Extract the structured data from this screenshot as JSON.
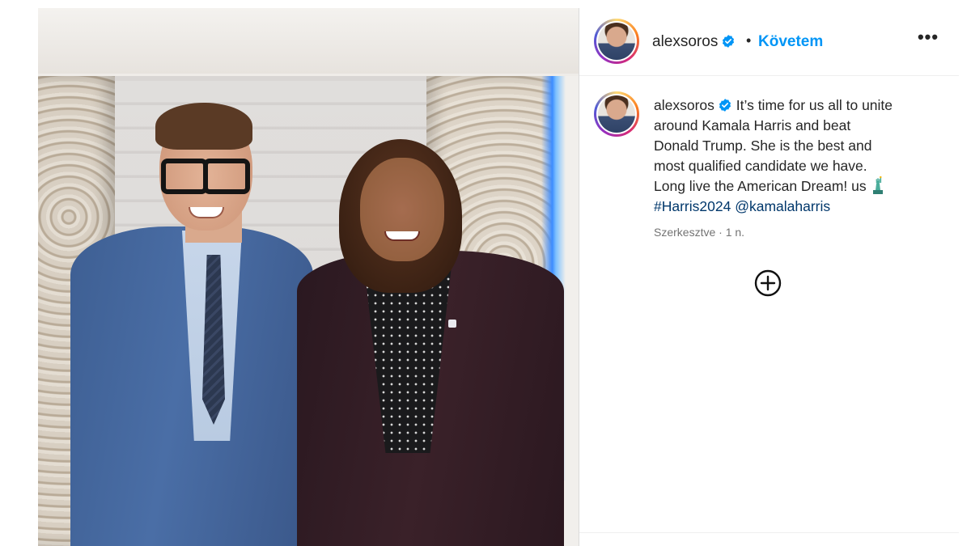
{
  "post": {
    "author": {
      "username": "alexsoros",
      "verified": true,
      "follow_status": "Követem"
    },
    "header": {
      "separator": "•",
      "more_label": "•••"
    },
    "caption": {
      "username": "alexsoros",
      "text_line_1": "It’s time for us all to unite",
      "text_line_2": "around Kamala Harris and beat",
      "text_line_3": "Donald Trump. She is the best and",
      "text_line_4": "most qualified candidate we have.",
      "text_line_5": "Long live the American Dream! us",
      "hashtag": "#Harris2024",
      "mention": "@kamalaharris"
    },
    "meta": "Szerkesztve · 1 n.",
    "icons": {
      "verified": "verified-badge-icon",
      "more": "more-options-icon",
      "statue": "statue-of-liberty-emoji",
      "add_comment": "plus-circle-icon"
    },
    "colors": {
      "link_blue": "#0095f6",
      "hashtag_blue": "#00376b",
      "verified_blue": "#0095f6",
      "meta_gray": "#737373"
    }
  }
}
